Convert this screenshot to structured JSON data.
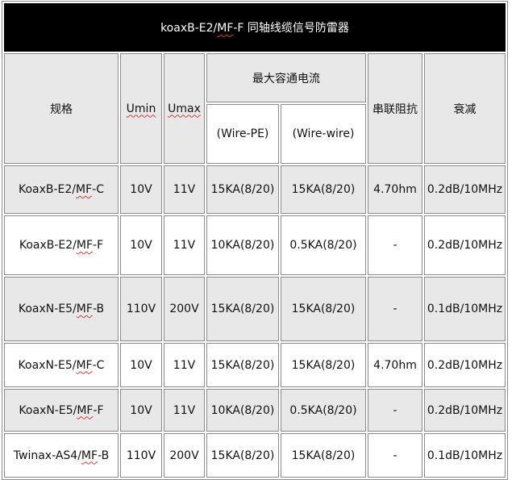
{
  "title": {
    "prefix": "koaxB-E2/",
    "underlined": "MF",
    "suffix": "-F 同轴线缆信号防雷器"
  },
  "headers": {
    "spec": "规格",
    "umin": "Umin",
    "umax": "Umax",
    "max_current": "最大容通电流",
    "wire_pe": "(Wire-PE)",
    "wire_wire": "(Wire-wire)",
    "series_res": "串联阻抗",
    "atten": "衰减"
  },
  "rows": [
    {
      "model_prefix": "KoaxB-E2/",
      "model_mf": "MF",
      "model_suffix": "-C",
      "umin": "10V",
      "umax": "11V",
      "wire_pe": "15KA(8/20)",
      "wire_wire": "15KA(8/20)",
      "res": "4.70hm",
      "atten": "0.2dB/10MHz",
      "shade": "gray"
    },
    {
      "model_prefix": "KoaxB-E2/",
      "model_mf": "MF",
      "model_suffix": "-F",
      "umin": "10V",
      "umax": "11V",
      "wire_pe": "10KA(8/20)",
      "wire_wire": "0.5KA(8/20)",
      "res": "-",
      "atten": "0.2dB/10MHz",
      "shade": "white"
    },
    {
      "model_prefix": "KoaxN-E5/",
      "model_mf": "MF",
      "model_suffix": "-B",
      "umin": "110V",
      "umax": "200V",
      "wire_pe": "15KA(8/20)",
      "wire_wire": "15KA(8/20)",
      "res": "-",
      "atten": "0.1dB/10MHz",
      "shade": "gray"
    },
    {
      "model_prefix": "KoaxN-E5/",
      "model_mf": "MF",
      "model_suffix": "-C",
      "umin": "10V",
      "umax": "11V",
      "wire_pe": "15KA(8/20)",
      "wire_wire": "15KA(8/20)",
      "res": "4.70hm",
      "atten": "0.2dB/10MHz",
      "shade": "white"
    },
    {
      "model_prefix": "KoaxN-E5/",
      "model_mf": "MF",
      "model_suffix": "-F",
      "umin": "10V",
      "umax": "11V",
      "wire_pe": "10KA(8/20)",
      "wire_wire": "0.5KA(8/20)",
      "res": "-",
      "atten": "0.2dB/10MHz",
      "shade": "gray"
    },
    {
      "model_prefix": "Twinax-AS4/",
      "model_mf": "MF",
      "model_suffix": "-B",
      "umin": "110V",
      "umax": "200V",
      "wire_pe": "15KA(8/20)",
      "wire_wire": "15KA(8/20)",
      "res": "-",
      "atten": "0.1dB/10MHz",
      "shade": "white"
    }
  ]
}
